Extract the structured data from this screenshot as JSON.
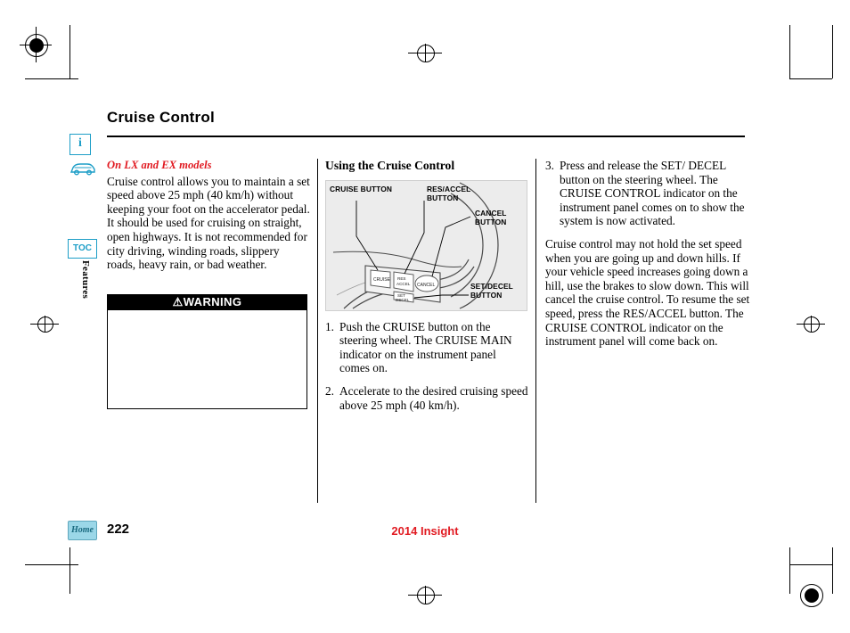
{
  "header": {
    "chapter_title": "Cruise Control"
  },
  "rail": {
    "info_icon_letter": "i",
    "toc_label": "TOC",
    "section_label": "Features"
  },
  "column1": {
    "model_note": "On LX and EX models",
    "paragraph": "Cruise control allows you to maintain a set speed above 25 mph (40 km/h) without keeping your foot on the accelerator pedal. It should be used for cruising on straight, open highways. It is not recommended for city driving, winding roads, slippery roads, heavy rain, or bad weather.",
    "warning_label": "WARNING",
    "warning_body": ""
  },
  "column2": {
    "heading": "Using the Cruise Control",
    "figure": {
      "labels": [
        "CRUISE BUTTON",
        "RES/ACCEL\nBUTTON",
        "CANCEL\nBUTTON",
        "SET/DECEL\nBUTTON"
      ],
      "button_texts": [
        "CRUISE",
        "RES\nACCEL",
        "CANCEL",
        "SET\nDECEL"
      ]
    },
    "steps": [
      {
        "num": "1.",
        "text": "Push the CRUISE button on the steering wheel. The CRUISE MAIN indicator on the instrument panel comes on."
      },
      {
        "num": "2.",
        "text": "Accelerate to the desired cruising speed above 25 mph (40 km/h)."
      }
    ]
  },
  "column3": {
    "steps": [
      {
        "num": "3.",
        "text": "Press and release the SET/ DECEL button on the steering wheel. The CRUISE CONTROL indicator on the instrument panel comes on to show the system is now activated."
      }
    ],
    "paragraph": "Cruise control may not hold the set speed when you are going up and down hills. If your vehicle speed increases going down a hill, use the brakes to slow down. This will cancel the cruise control. To resume the set speed, press the RES/ACCEL button. The CRUISE CONTROL indicator on the instrument panel will come back on."
  },
  "footer": {
    "home_label": "Home",
    "page_number": "222",
    "model_year": "2014 Insight"
  },
  "colors": {
    "accent_red": "#e11b22",
    "icon_cyan": "#1d9ec7",
    "home_blue": "#9bd7e8"
  }
}
